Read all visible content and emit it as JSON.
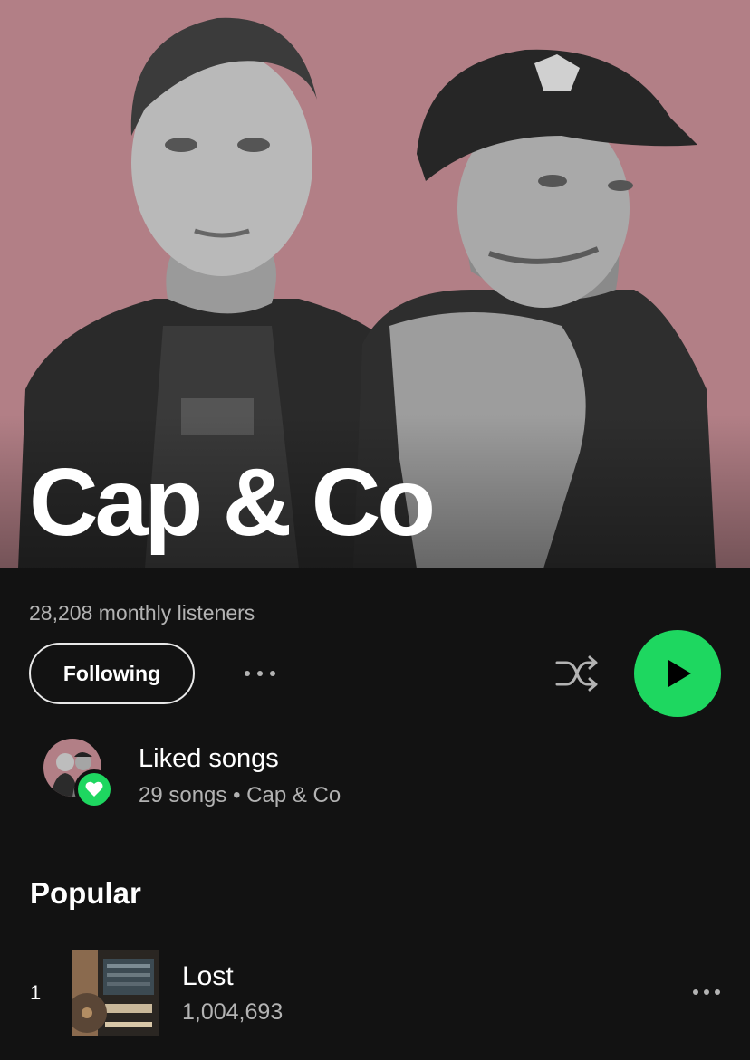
{
  "artist": {
    "name": "Cap & Co",
    "monthly_listeners": "28,208 monthly listeners"
  },
  "actions": {
    "follow_label": "Following"
  },
  "liked": {
    "title": "Liked songs",
    "subtitle": "29 songs • Cap & Co"
  },
  "popular": {
    "heading": "Popular",
    "tracks": [
      {
        "rank": "1",
        "title": "Lost",
        "plays": "1,004,693"
      }
    ]
  },
  "colors": {
    "hero_bg": "#b27f86",
    "page_bg": "#121212",
    "accent_green": "#1ed760",
    "secondary_text": "#b3b3b3"
  }
}
